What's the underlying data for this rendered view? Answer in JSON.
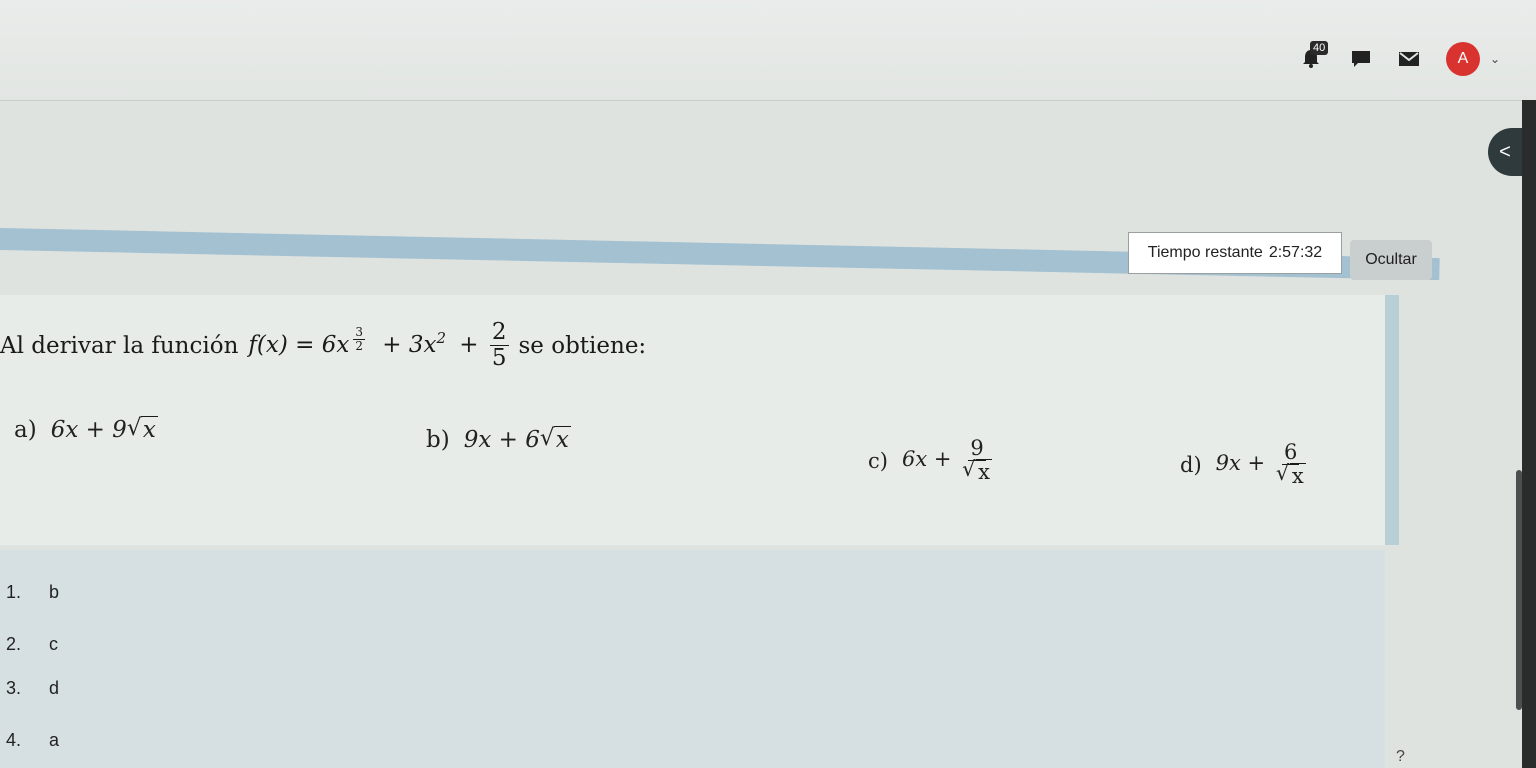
{
  "header": {
    "notification_count": "40",
    "avatar_initial": "A",
    "icons": [
      "bell-icon",
      "chat-icon",
      "mail-icon",
      "chevron-down-icon"
    ]
  },
  "drawer": {
    "toggle_glyph": "<"
  },
  "timer": {
    "label": "Tiempo restante",
    "value": "2:57:32",
    "hide_label": "Ocultar"
  },
  "question": {
    "intro": "Al derivar la función",
    "function_lhs": "f(x) = 6x",
    "exp_num": "3",
    "exp_den": "2",
    "mid": "+ 3x",
    "square": "2",
    "plus": "+",
    "const_num": "2",
    "const_den": "5",
    "outro": "se obtiene:"
  },
  "options": {
    "a": {
      "label": "a)",
      "coef": "6x + 9",
      "rad": "x"
    },
    "b": {
      "label": "b)",
      "coef": "9x + 6",
      "rad": "x"
    },
    "c": {
      "label": "c)",
      "lead": "6x +",
      "num": "9",
      "rad": "x"
    },
    "d": {
      "label": "d)",
      "lead": "9x +",
      "num": "6",
      "rad": "x"
    }
  },
  "answers": [
    {
      "num": "1.",
      "value": "b"
    },
    {
      "num": "2.",
      "value": "c"
    },
    {
      "num": "3.",
      "value": "d"
    },
    {
      "num": "4.",
      "value": "a"
    }
  ],
  "help": "?",
  "colors": {
    "avatar": "#d9332f",
    "band": "#8fb6cc",
    "answers_bg": "#d6e0e3"
  }
}
